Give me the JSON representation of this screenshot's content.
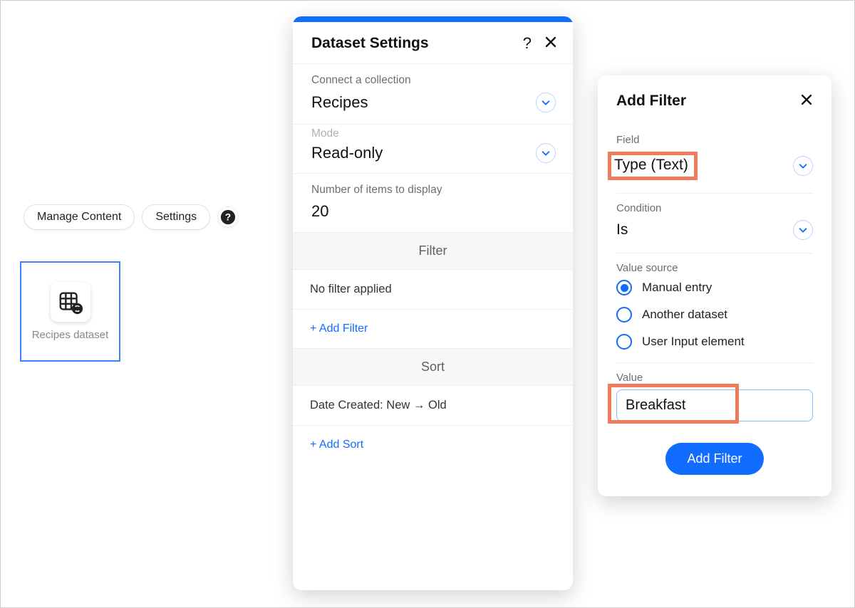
{
  "toolbar": {
    "manage_content": "Manage Content",
    "settings": "Settings"
  },
  "dataset_element": {
    "label": "Recipes dataset"
  },
  "settings_panel": {
    "title": "Dataset Settings",
    "connect_label": "Connect a collection",
    "connect_value": "Recipes",
    "mode_label": "Mode",
    "mode_value": "Read-only",
    "items_label": "Number of items to display",
    "items_value": "20",
    "filter_header": "Filter",
    "no_filter": "No filter applied",
    "add_filter": "+ Add Filter",
    "sort_header": "Sort",
    "sort_value": "Date Created: New → Old",
    "add_sort": "+ Add Sort"
  },
  "filter_panel": {
    "title": "Add Filter",
    "field_label": "Field",
    "field_value": "Type (Text)",
    "condition_label": "Condition",
    "condition_value": "Is",
    "value_source_label": "Value source",
    "sources": {
      "manual": "Manual entry",
      "another": "Another dataset",
      "user_input": "User Input element"
    },
    "selected_source": "manual",
    "value_label": "Value",
    "value": "Breakfast",
    "submit": "Add Filter"
  }
}
